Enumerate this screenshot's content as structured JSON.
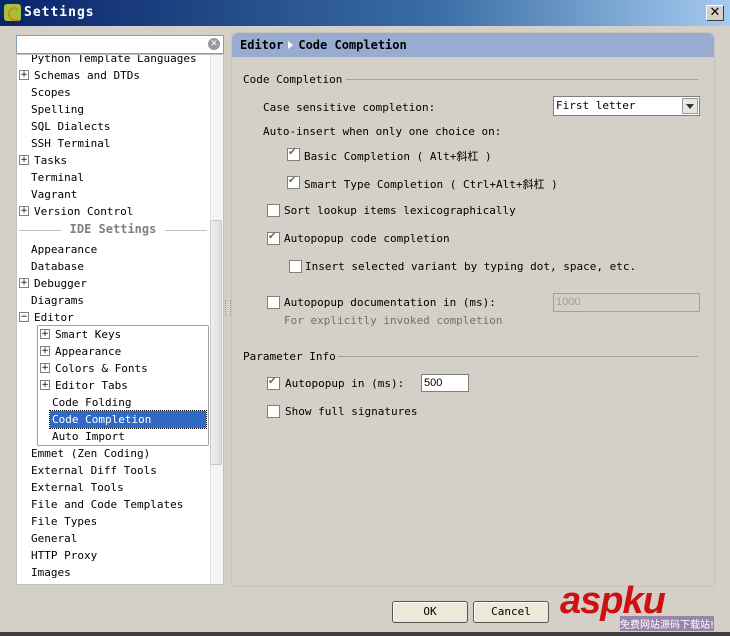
{
  "window": {
    "title": "Settings",
    "close_label": "✕"
  },
  "search": {
    "value": "",
    "placeholder": ""
  },
  "tree": {
    "project_items": [
      {
        "label": "Python Template Languages",
        "expandable": false
      },
      {
        "label": "Schemas and DTDs",
        "expandable": true
      },
      {
        "label": "Scopes",
        "expandable": false
      },
      {
        "label": "Spelling",
        "expandable": false
      },
      {
        "label": "SQL Dialects",
        "expandable": false
      },
      {
        "label": "SSH Terminal",
        "expandable": false
      },
      {
        "label": "Tasks",
        "expandable": true
      },
      {
        "label": "Terminal",
        "expandable": false
      },
      {
        "label": "Vagrant",
        "expandable": false
      },
      {
        "label": "Version Control",
        "expandable": true
      }
    ],
    "section_label": "IDE Settings",
    "ide_items": [
      {
        "label": "Appearance",
        "expandable": false
      },
      {
        "label": "Database",
        "expandable": false
      },
      {
        "label": "Debugger",
        "expandable": true
      },
      {
        "label": "Diagrams",
        "expandable": false
      },
      {
        "label": "Editor",
        "expandable": true,
        "expanded": true
      }
    ],
    "editor_children": [
      {
        "label": "Smart Keys",
        "expandable": true
      },
      {
        "label": "Appearance",
        "expandable": true
      },
      {
        "label": "Colors & Fonts",
        "expandable": true
      },
      {
        "label": "Editor Tabs",
        "expandable": true
      },
      {
        "label": "Code Folding",
        "expandable": false
      },
      {
        "label": "Code Completion",
        "expandable": false,
        "selected": true
      },
      {
        "label": "Auto Import",
        "expandable": false
      }
    ],
    "after_items": [
      {
        "label": "Emmet (Zen Coding)"
      },
      {
        "label": "External Diff Tools"
      },
      {
        "label": "External Tools"
      },
      {
        "label": "File and Code Templates"
      },
      {
        "label": "File Types"
      },
      {
        "label": "General"
      },
      {
        "label": "HTTP Proxy"
      },
      {
        "label": "Images"
      }
    ]
  },
  "panel": {
    "breadcrumb": [
      "Editor",
      "Code Completion"
    ],
    "code_completion": {
      "title": "Code Completion",
      "case_sensitive_label": "Case sensitive completion:",
      "case_sensitive_value": "First letter",
      "auto_insert_label": "Auto-insert when only one choice on:",
      "basic_completion": {
        "label": "Basic Completion ( Alt+斜杠 )",
        "checked": true
      },
      "smart_type_completion": {
        "label": "Smart Type Completion ( Ctrl+Alt+斜杠 )",
        "checked": true
      },
      "sort_lexicographically": {
        "label": "Sort lookup items lexicographically",
        "checked": false
      },
      "autopopup_code": {
        "label": "Autopopup code completion",
        "checked": true
      },
      "insert_selected_variant": {
        "label": "Insert selected variant by typing dot, space, etc.",
        "checked": false
      },
      "autopopup_documentation": {
        "label": "Autopopup documentation in (ms):",
        "checked": false,
        "value": "1000"
      },
      "documentation_hint": "For explicitly invoked completion"
    },
    "parameter_info": {
      "title": "Parameter Info",
      "autopopup": {
        "label": "Autopopup in (ms):",
        "checked": true,
        "value": "500"
      },
      "show_full_signatures": {
        "label": "Show full signatures",
        "checked": false
      }
    }
  },
  "buttons": {
    "ok": "OK",
    "cancel": "Cancel"
  },
  "watermark": {
    "brand": "aspku",
    "tagline": "免费网站源码下载站!"
  },
  "colors": {
    "titlebar": "#0a246a",
    "selection": "#316ac5",
    "panel_header": "#97acd0",
    "watermark": "#d01010"
  }
}
